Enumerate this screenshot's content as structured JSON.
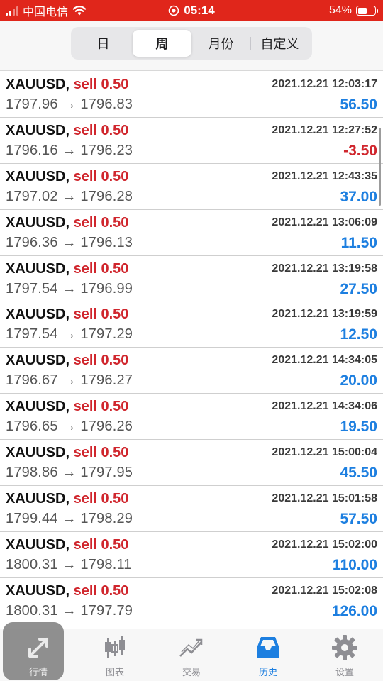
{
  "status_bar": {
    "carrier": "中国电信",
    "time": "05:14",
    "battery": "54%",
    "battery_level": 0.54
  },
  "period_tabs": [
    {
      "label": "日",
      "active": false
    },
    {
      "label": "周",
      "active": true
    },
    {
      "label": "月份",
      "active": false
    },
    {
      "label": "自定义",
      "active": false
    }
  ],
  "trades": [
    {
      "symbol": "XAUUSD,",
      "side": "sell 0.50",
      "time": "2021.12.21 12:03:17",
      "prices": "1797.96 → 1796.83",
      "profit": "56.50"
    },
    {
      "symbol": "XAUUSD,",
      "side": "sell 0.50",
      "time": "2021.12.21 12:27:52",
      "prices": "1796.16 → 1796.23",
      "profit": "-3.50"
    },
    {
      "symbol": "XAUUSD,",
      "side": "sell 0.50",
      "time": "2021.12.21 12:43:35",
      "prices": "1797.02 → 1796.28",
      "profit": "37.00"
    },
    {
      "symbol": "XAUUSD,",
      "side": "sell 0.50",
      "time": "2021.12.21 13:06:09",
      "prices": "1796.36 → 1796.13",
      "profit": "11.50"
    },
    {
      "symbol": "XAUUSD,",
      "side": "sell 0.50",
      "time": "2021.12.21 13:19:58",
      "prices": "1797.54 → 1796.99",
      "profit": "27.50"
    },
    {
      "symbol": "XAUUSD,",
      "side": "sell 0.50",
      "time": "2021.12.21 13:19:59",
      "prices": "1797.54 → 1797.29",
      "profit": "12.50"
    },
    {
      "symbol": "XAUUSD,",
      "side": "sell 0.50",
      "time": "2021.12.21 14:34:05",
      "prices": "1796.67 → 1796.27",
      "profit": "20.00"
    },
    {
      "symbol": "XAUUSD,",
      "side": "sell 0.50",
      "time": "2021.12.21 14:34:06",
      "prices": "1796.65 → 1796.26",
      "profit": "19.50"
    },
    {
      "symbol": "XAUUSD,",
      "side": "sell 0.50",
      "time": "2021.12.21 15:00:04",
      "prices": "1798.86 → 1797.95",
      "profit": "45.50"
    },
    {
      "symbol": "XAUUSD,",
      "side": "sell 0.50",
      "time": "2021.12.21 15:01:58",
      "prices": "1799.44 → 1798.29",
      "profit": "57.50"
    },
    {
      "symbol": "XAUUSD,",
      "side": "sell 0.50",
      "time": "2021.12.21 15:02:00",
      "prices": "1800.31 → 1798.11",
      "profit": "110.00"
    },
    {
      "symbol": "XAUUSD,",
      "side": "sell 0.50",
      "time": "2021.12.21 15:02:08",
      "prices": "1800.31 → 1797.79",
      "profit": "126.00"
    }
  ],
  "colors": {
    "status_bar_bg": "#e0261b",
    "sell_text": "#d0262d",
    "profit_positive": "#1d7fe0",
    "profit_negative": "#d0262d",
    "tab_active": "#1d7fe0"
  },
  "bottom_tabs": [
    {
      "label": "行情",
      "icon": "quotes-icon",
      "active": false,
      "pressed": true
    },
    {
      "label": "图表",
      "icon": "chart-icon",
      "active": false
    },
    {
      "label": "交易",
      "icon": "trade-icon",
      "active": false
    },
    {
      "label": "历史",
      "icon": "history-icon",
      "active": true
    },
    {
      "label": "设置",
      "icon": "gear-icon",
      "active": false
    }
  ]
}
